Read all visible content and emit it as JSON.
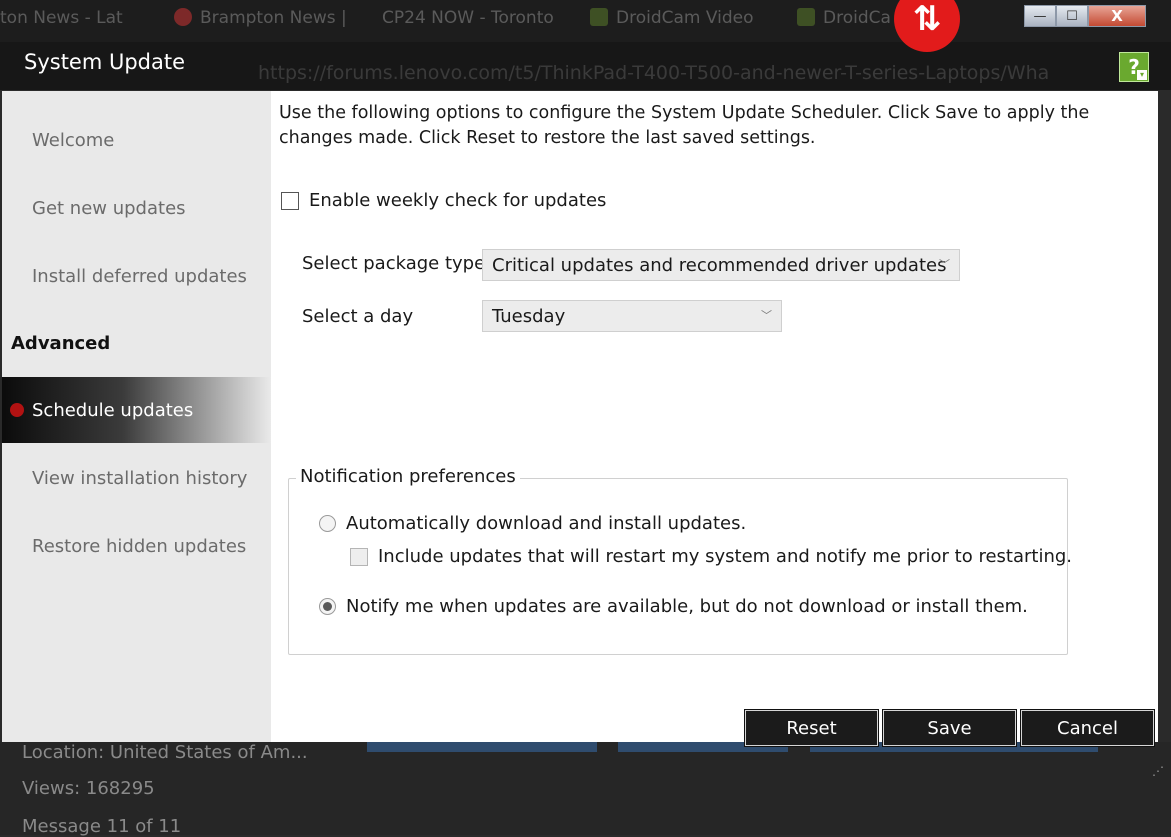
{
  "background": {
    "tabs": [
      "ton News - Lat",
      "Brampton News |",
      "CP24 NOW - Toronto",
      "DroidCam Video",
      "DroidCa"
    ],
    "url": "https://forums.lenovo.com/t5/ThinkPad-T400-T500-and-newer-T-series-Laptops/Wha",
    "bottom_lines": [
      "Location: United States of Am...",
      "Views: 168295",
      "Message 11 of 11"
    ]
  },
  "window": {
    "title": "System Update",
    "help_label": "?",
    "controls": [
      "—",
      "☐",
      "X"
    ]
  },
  "sidebar": {
    "items": [
      {
        "label": "Welcome"
      },
      {
        "label": "Get new updates"
      },
      {
        "label": "Install deferred updates"
      },
      {
        "label": "Schedule updates"
      },
      {
        "label": "View installation history"
      },
      {
        "label": "Restore hidden updates"
      }
    ],
    "section_header": "Advanced",
    "active_item": "Schedule updates"
  },
  "content": {
    "description": "Use the following options to configure the System Update Scheduler. Click Save to apply the changes made. Click Reset to restore the last saved settings.",
    "weekly_check_label": "Enable weekly check for updates",
    "weekly_check_checked": false,
    "package_type_label": "Select package type:",
    "package_type_value": "Critical updates and recommended driver updates",
    "day_label": "Select a day",
    "day_value": "Tuesday",
    "notification": {
      "legend": "Notification preferences",
      "option_auto": "Automatically download and install updates.",
      "option_auto_checked": false,
      "include_restart": "Include updates that will restart my system and notify me prior to restarting.",
      "option_notify": "Notify me when updates are available, but do not download or install them.",
      "option_notify_checked": true
    }
  },
  "footer": {
    "reset": "Reset",
    "save": "Save",
    "cancel": "Cancel"
  },
  "colors": {
    "active_dot": "#b21212",
    "help_green": "#6aa92f",
    "logo_red": "#e21b1b"
  }
}
